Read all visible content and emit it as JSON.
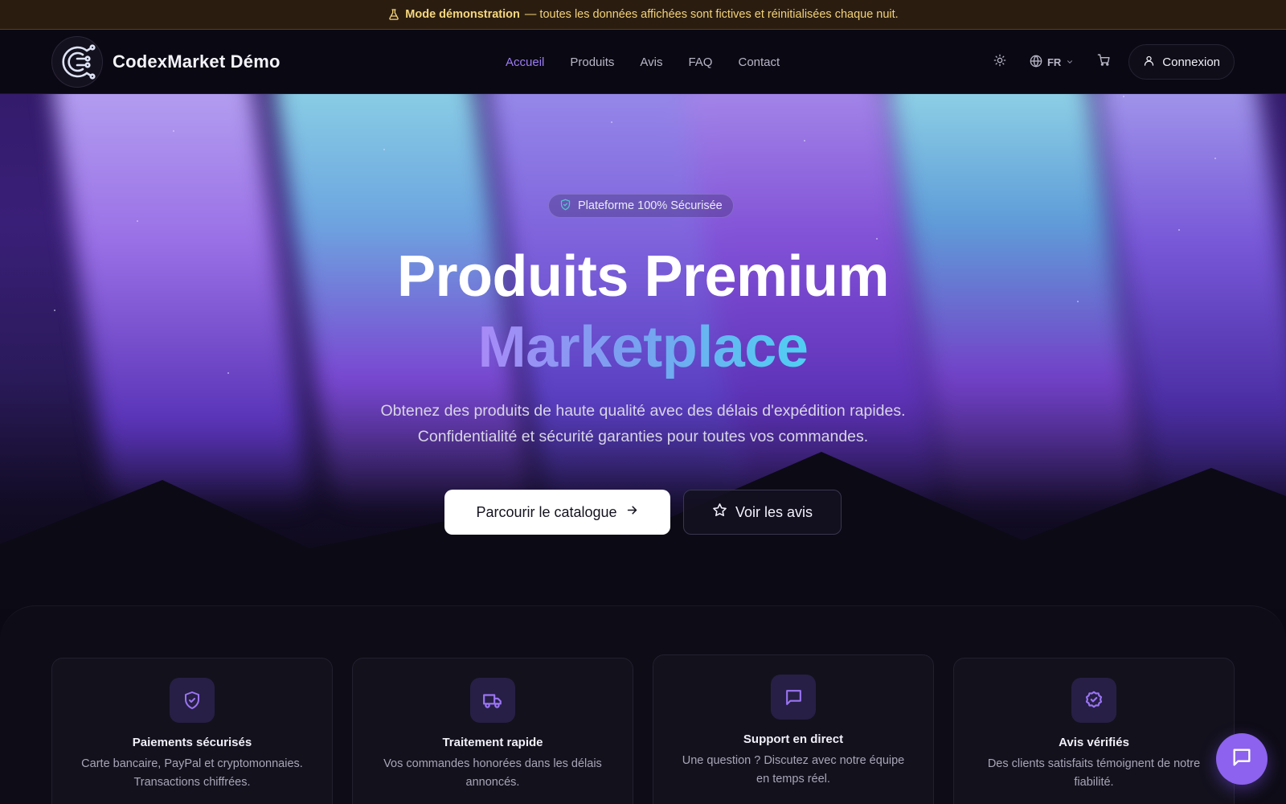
{
  "banner": {
    "icon": "flask-icon",
    "strong": "Mode démonstration",
    "text": "— toutes les données affichées sont fictives et réinitialisées chaque nuit."
  },
  "header": {
    "brand": "CodexMarket Démo",
    "nav": [
      {
        "label": "Accueil",
        "active": true
      },
      {
        "label": "Produits",
        "active": false
      },
      {
        "label": "Avis",
        "active": false
      },
      {
        "label": "FAQ",
        "active": false
      },
      {
        "label": "Contact",
        "active": false
      }
    ],
    "theme_icon": "sun-icon",
    "lang_icon": "globe-icon",
    "lang": "FR",
    "cart_icon": "cart-icon",
    "login_label": "Connexion"
  },
  "hero": {
    "badge": "Plateforme 100% Sécurisée",
    "title_line1": "Produits Premium",
    "title_line2": "Marketplace",
    "lead_line1": "Obtenez des produits de haute qualité avec des délais d'expédition rapides.",
    "lead_line2": "Confidentialité et sécurité garanties pour toutes vos commandes.",
    "cta_primary": "Parcourir le catalogue",
    "cta_secondary": "Voir les avis"
  },
  "features": [
    {
      "icon": "shield-check-icon",
      "title": "Paiements sécurisés",
      "line1": "Carte bancaire, PayPal et cryptomonnaies.",
      "line2": "Transactions chiffrées."
    },
    {
      "icon": "truck-icon",
      "title": "Traitement rapide",
      "line1": "Vos commandes honorées dans les délais",
      "line2": "annoncés."
    },
    {
      "icon": "message-icon",
      "title": "Support en direct",
      "line1": "Une question ? Discutez avec notre équipe",
      "line2": "en temps réel."
    },
    {
      "icon": "badge-check-icon",
      "title": "Avis vérifiés",
      "line1": "Des clients satisfaits témoignent de notre",
      "line2": "fiabilité."
    }
  ],
  "colors": {
    "accent": "#8c62ee",
    "nav_active": "#9b7cf6",
    "banner_bg": "#2a1d10",
    "banner_text": "#f3d27a",
    "page_bg": "#0b0913"
  }
}
